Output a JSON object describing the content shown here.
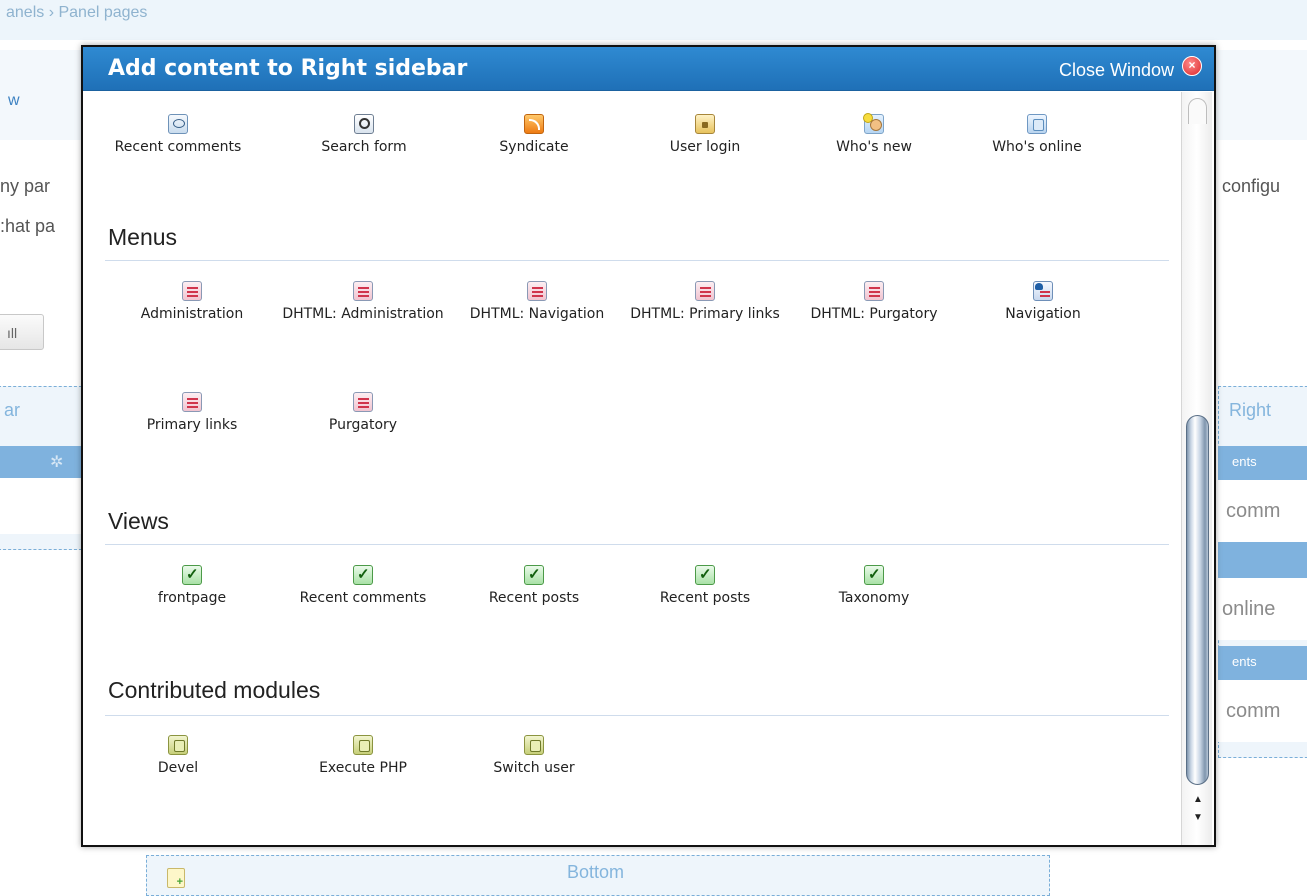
{
  "background": {
    "breadcrumb": "anels › Panel pages",
    "tab_fragment": "w",
    "text_left_1": "ny par",
    "text_left_2": ":hat pa",
    "text_right_1": "configu",
    "button_fragment": "ıll",
    "left_region_label": "ar",
    "right_region_label": "Right",
    "right_bar_1": "ents",
    "right_pane_1": "comm",
    "right_pane_2": "online",
    "right_bar_3": "ents",
    "right_pane_3": "comm",
    "bottom_region_label": "Bottom"
  },
  "modal": {
    "title": "Add content to Right sidebar",
    "close_label": "Close Window",
    "close_icon": "close-icon"
  },
  "top_items": [
    {
      "label": "Recent comments",
      "icon": "comment-icon"
    },
    {
      "label": "Search form",
      "icon": "search-icon"
    },
    {
      "label": "Syndicate",
      "icon": "feed-icon"
    },
    {
      "label": "User login",
      "icon": "lock-icon"
    },
    {
      "label": "Who's new",
      "icon": "user-face-icon"
    },
    {
      "label": "Who's online",
      "icon": "block-icon"
    }
  ],
  "sections": {
    "menus": {
      "title": "Menus",
      "items": [
        {
          "label": "Administration",
          "icon": "menu-icon"
        },
        {
          "label": "DHTML: Administration",
          "icon": "menu-icon"
        },
        {
          "label": "DHTML: Navigation",
          "icon": "menu-icon"
        },
        {
          "label": "DHTML: Primary links",
          "icon": "menu-icon"
        },
        {
          "label": "DHTML: Purgatory",
          "icon": "menu-icon"
        },
        {
          "label": "Navigation",
          "icon": "navigation-menu-icon"
        },
        {
          "label": "Primary links",
          "icon": "menu-icon"
        },
        {
          "label": "Purgatory",
          "icon": "menu-icon"
        }
      ]
    },
    "views": {
      "title": "Views",
      "items": [
        {
          "label": "frontpage",
          "icon": "view-icon"
        },
        {
          "label": "Recent comments",
          "icon": "view-icon"
        },
        {
          "label": "Recent posts",
          "icon": "view-icon"
        },
        {
          "label": "Recent posts",
          "icon": "view-icon"
        },
        {
          "label": "Taxonomy",
          "icon": "view-icon"
        }
      ]
    },
    "contributed": {
      "title": "Contributed modules",
      "items": [
        {
          "label": "Devel",
          "icon": "module-icon"
        },
        {
          "label": "Execute PHP",
          "icon": "module-icon"
        },
        {
          "label": "Switch user",
          "icon": "module-icon"
        }
      ]
    }
  },
  "colors": {
    "header": "#1f70b7",
    "section_rule": "#cfdcec",
    "background_accent": "#7fb2de"
  }
}
